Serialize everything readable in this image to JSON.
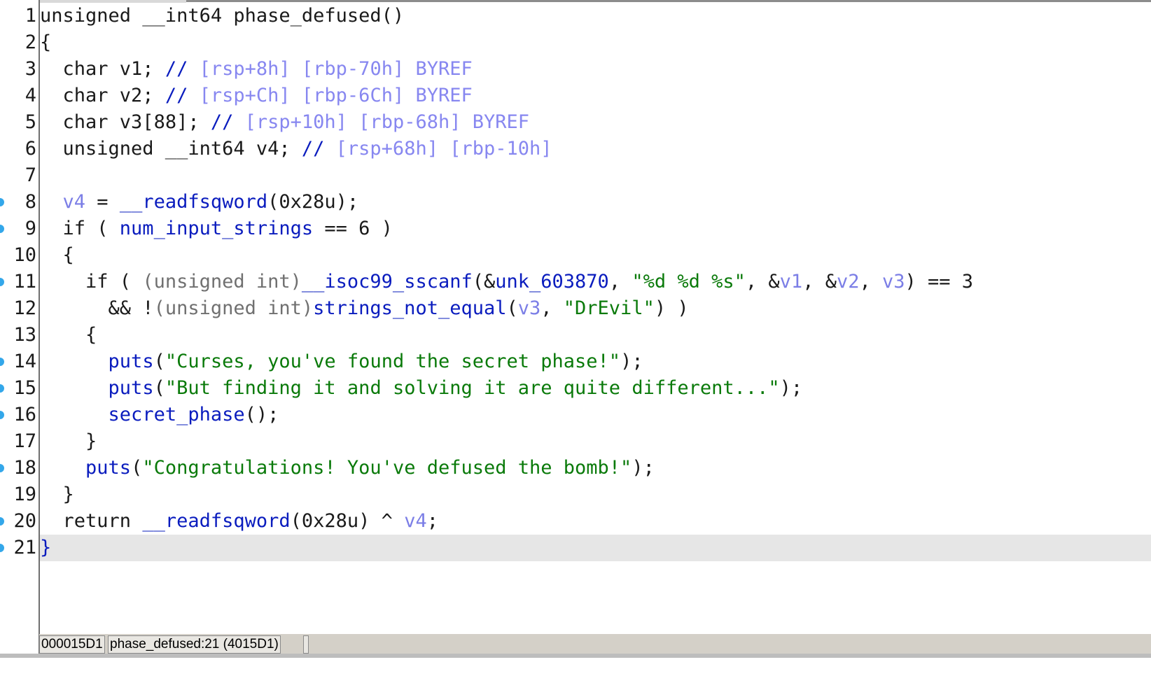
{
  "editor": {
    "lines": [
      {
        "n": "1",
        "tokens": [
          {
            "c": "kw",
            "t": "unsigned __int64 "
          },
          {
            "c": "kw",
            "t": "phase_defused"
          },
          {
            "c": "kw",
            "t": "()"
          }
        ]
      },
      {
        "n": "2",
        "tokens": [
          {
            "c": "kw",
            "t": "{"
          }
        ]
      },
      {
        "n": "3",
        "tokens": [
          {
            "c": "kw",
            "t": "  char "
          },
          {
            "c": "kw",
            "t": "v1; "
          },
          {
            "c": "fn",
            "t": "// "
          },
          {
            "c": "cm",
            "t": "[rsp+8h] [rbp-70h] BYREF"
          }
        ]
      },
      {
        "n": "4",
        "tokens": [
          {
            "c": "kw",
            "t": "  char "
          },
          {
            "c": "kw",
            "t": "v2; "
          },
          {
            "c": "fn",
            "t": "// "
          },
          {
            "c": "cm",
            "t": "[rsp+Ch] [rbp-6Ch] BYREF"
          }
        ]
      },
      {
        "n": "5",
        "tokens": [
          {
            "c": "kw",
            "t": "  char "
          },
          {
            "c": "kw",
            "t": "v3[88]; "
          },
          {
            "c": "fn",
            "t": "// "
          },
          {
            "c": "cm",
            "t": "[rsp+10h] [rbp-68h] BYREF"
          }
        ]
      },
      {
        "n": "6",
        "tokens": [
          {
            "c": "kw",
            "t": "  unsigned __int64 v4; "
          },
          {
            "c": "fn",
            "t": "// "
          },
          {
            "c": "cm",
            "t": "[rsp+68h] [rbp-10h]"
          }
        ]
      },
      {
        "n": "7",
        "tokens": []
      },
      {
        "n": "8",
        "bp": true,
        "tokens": [
          {
            "c": "kw",
            "t": "  "
          },
          {
            "c": "var",
            "t": "v4"
          },
          {
            "c": "kw",
            "t": " = "
          },
          {
            "c": "fn",
            "t": "__readfsqword"
          },
          {
            "c": "kw",
            "t": "(0x28u);"
          }
        ]
      },
      {
        "n": "9",
        "bp": true,
        "tokens": [
          {
            "c": "kw",
            "t": "  if ( "
          },
          {
            "c": "fn",
            "t": "num_input_strings"
          },
          {
            "c": "kw",
            "t": " == 6 )"
          }
        ]
      },
      {
        "n": "10",
        "tokens": [
          {
            "c": "kw",
            "t": "  {"
          }
        ]
      },
      {
        "n": "11",
        "bp": true,
        "tokens": [
          {
            "c": "kw",
            "t": "    if ( "
          },
          {
            "c": "cast",
            "t": "(unsigned int)"
          },
          {
            "c": "fn",
            "t": "__isoc99_sscanf"
          },
          {
            "c": "kw",
            "t": "(&"
          },
          {
            "c": "fn",
            "t": "unk_603870"
          },
          {
            "c": "kw",
            "t": ", "
          },
          {
            "c": "str",
            "t": "\"%d %d %s\""
          },
          {
            "c": "kw",
            "t": ", &"
          },
          {
            "c": "var",
            "t": "v1"
          },
          {
            "c": "kw",
            "t": ", &"
          },
          {
            "c": "var",
            "t": "v2"
          },
          {
            "c": "kw",
            "t": ", "
          },
          {
            "c": "var",
            "t": "v3"
          },
          {
            "c": "kw",
            "t": ") == 3"
          }
        ]
      },
      {
        "n": "12",
        "tokens": [
          {
            "c": "kw",
            "t": "      && !"
          },
          {
            "c": "cast",
            "t": "(unsigned int)"
          },
          {
            "c": "fn",
            "t": "strings_not_equal"
          },
          {
            "c": "kw",
            "t": "("
          },
          {
            "c": "var",
            "t": "v3"
          },
          {
            "c": "kw",
            "t": ", "
          },
          {
            "c": "str",
            "t": "\"DrEvil\""
          },
          {
            "c": "kw",
            "t": ") )"
          }
        ]
      },
      {
        "n": "13",
        "tokens": [
          {
            "c": "kw",
            "t": "    {"
          }
        ]
      },
      {
        "n": "14",
        "bp": true,
        "tokens": [
          {
            "c": "kw",
            "t": "      "
          },
          {
            "c": "fn",
            "t": "puts"
          },
          {
            "c": "kw",
            "t": "("
          },
          {
            "c": "str",
            "t": "\"Curses, you've found the secret phase!\""
          },
          {
            "c": "kw",
            "t": ");"
          }
        ]
      },
      {
        "n": "15",
        "bp": true,
        "tokens": [
          {
            "c": "kw",
            "t": "      "
          },
          {
            "c": "fn",
            "t": "puts"
          },
          {
            "c": "kw",
            "t": "("
          },
          {
            "c": "str",
            "t": "\"But finding it and solving it are quite different...\""
          },
          {
            "c": "kw",
            "t": ");"
          }
        ]
      },
      {
        "n": "16",
        "bp": true,
        "tokens": [
          {
            "c": "kw",
            "t": "      "
          },
          {
            "c": "fn",
            "t": "secret_phase"
          },
          {
            "c": "kw",
            "t": "();"
          }
        ]
      },
      {
        "n": "17",
        "tokens": [
          {
            "c": "kw",
            "t": "    }"
          }
        ]
      },
      {
        "n": "18",
        "bp": true,
        "tokens": [
          {
            "c": "kw",
            "t": "    "
          },
          {
            "c": "fn",
            "t": "puts"
          },
          {
            "c": "kw",
            "t": "("
          },
          {
            "c": "str",
            "t": "\"Congratulations! You've defused the bomb!\""
          },
          {
            "c": "kw",
            "t": ");"
          }
        ]
      },
      {
        "n": "19",
        "tokens": [
          {
            "c": "kw",
            "t": "  }"
          }
        ]
      },
      {
        "n": "20",
        "bp": true,
        "tokens": [
          {
            "c": "kw",
            "t": "  return "
          },
          {
            "c": "fn",
            "t": "__readfsqword"
          },
          {
            "c": "kw",
            "t": "(0x28u) ^ "
          },
          {
            "c": "var",
            "t": "v4"
          },
          {
            "c": "kw",
            "t": ";"
          }
        ]
      },
      {
        "n": "21",
        "bp": true,
        "current": true,
        "tokens": [
          {
            "c": "fn",
            "t": "}"
          }
        ]
      }
    ]
  },
  "status": {
    "address": "000015D1",
    "location": "phase_defused:21 (4015D1)"
  }
}
